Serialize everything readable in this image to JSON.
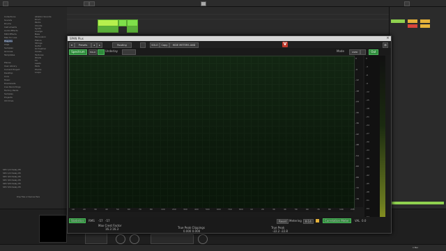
{
  "plugin": {
    "title": "SPAN Plus",
    "toolbar": {
      "presets": "Presets",
      "routing": "Routing",
      "solo": "SOLO",
      "copy": "Copy",
      "hide_meters": "HIDE METERS AND STATS",
      "logo": "V"
    },
    "spec_bar": {
      "spectrum": "Spectrum",
      "mode_box": "HOLD",
      "underlay": "Underlay",
      "mode_label": "Mode",
      "mode_value": "USER",
      "out": "Out"
    },
    "freq_labels": [
      "10",
      "20",
      "30",
      "40",
      "50",
      "60",
      "70",
      "80",
      "100",
      "200",
      "300",
      "400",
      "500",
      "600",
      "700",
      "800",
      "1K",
      "2K",
      "3K",
      "4K",
      "5K",
      "6K",
      "7K",
      "8K",
      "10K",
      "20K"
    ],
    "db_scale": [
      "0",
      "-6",
      "-12",
      "-18",
      "-24",
      "-30",
      "-36",
      "-42",
      "-48",
      "-54",
      "-60",
      "-66",
      "-72",
      "-78"
    ],
    "meter_scale": [
      "0",
      "-3",
      "-6",
      "-9",
      "-12",
      "-15",
      "-18",
      "-21",
      "-24",
      "-27",
      "-30",
      "-33",
      "-36",
      "-39",
      "-42",
      "-45",
      "-48",
      "-51",
      "-54",
      "-57",
      "-60"
    ],
    "stats": {
      "statistics": "Statistics",
      "rms_label": "RMS",
      "rms_l": "-57",
      "rms_r": "-57",
      "max_crest_label": "Max Crest Factor",
      "max_crest_value": "16.3 16.3",
      "true_peak_clip_label": "True Peak Clippings",
      "true_peak_clip_value": "0.000 0.000",
      "true_peak_label": "True Peak",
      "true_peak_value": "-22.2 -22.8",
      "reset": "Reset",
      "metering": "Metering",
      "metering_value": "K-14",
      "correlation": "Correlation Meter",
      "corr_value": "VAL",
      "corr_num": "0.0"
    }
  },
  "browser": {
    "left_items": [
      "Collections",
      "Sounds",
      "Drums",
      "Instruments",
      "Audio Effects",
      "MIDI Effects",
      "Max for Live",
      "Plug-Ins",
      "Clips",
      "Samples",
      "Grooves",
      "Templates"
    ],
    "right_items": [
      "Ableton Sounds",
      "Drum",
      "Packs",
      "Chords",
      "Synth",
      "Lounge",
      "Bass",
      "Percussion",
      "Pianos",
      "Strings",
      "Guitar",
      "Orchestral",
      "Vocals",
      "Textures",
      "Winds",
      "FX",
      "Leads",
      "Pads",
      "Plucks",
      "Loops"
    ],
    "places": [
      "Places",
      "User Library",
      "Current Project",
      "Desktop",
      "Core",
      "Music",
      "Downloads",
      "Live Recordings",
      "Factory Packs",
      "Samples",
      "Projects",
      "CD Drive"
    ]
  },
  "left_list": [
    "SPC 1/2 Delay 65",
    "SPC 1/2 Delay 65",
    "SPC 3/4 Delay 65",
    "SPC 3/4 Delay 65",
    "SPC 5/6 Delay 65",
    "SPC 5/6 Delay 65"
  ],
  "left_list_note": "Drop Files or Devices Here",
  "bottom": {
    "device_title": "Utility",
    "status_right": "1 Bar"
  },
  "colors": {
    "accent_green": "#7fe04a",
    "plugin_green": "#2f8a3c",
    "amber": "#e6b23a"
  }
}
